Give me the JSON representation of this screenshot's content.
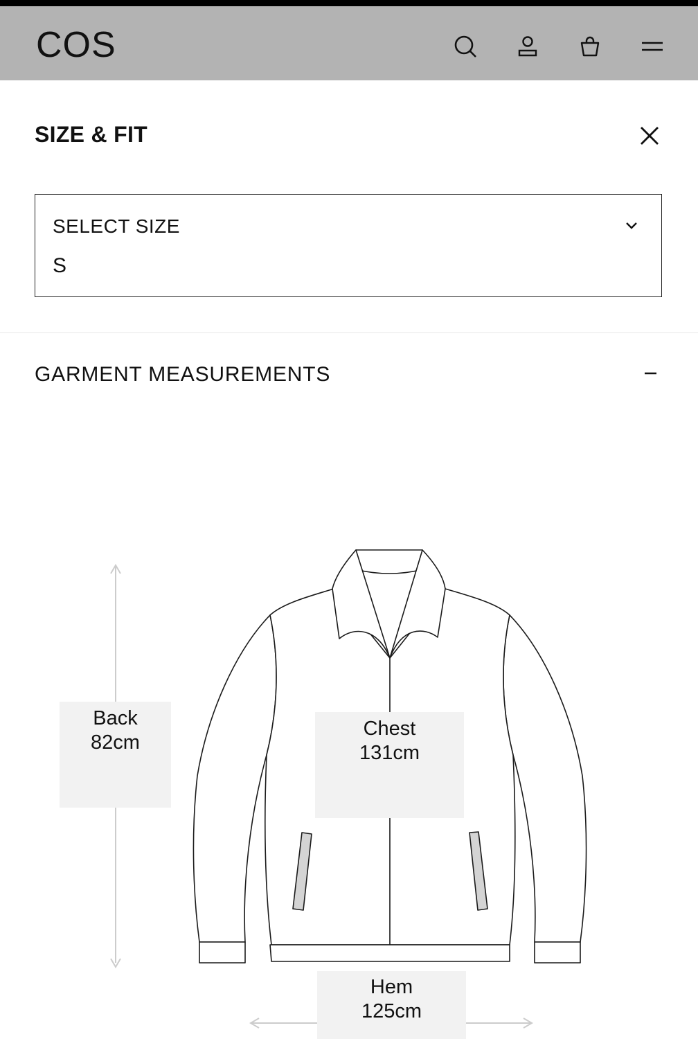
{
  "header": {
    "logo": "COS",
    "icons": [
      "search-icon",
      "account-icon",
      "shopping-bag-icon",
      "menu-icon"
    ]
  },
  "panel": {
    "title": "SIZE & FIT",
    "close_icon": "close-icon"
  },
  "size_select": {
    "label": "SELECT SIZE",
    "value": "S"
  },
  "garment": {
    "title": "GARMENT MEASUREMENTS",
    "toggle_icon": "collapse-minus-icon",
    "measurements": {
      "back": {
        "label": "Back",
        "value": "82cm"
      },
      "chest": {
        "label": "Chest",
        "value": "131cm"
      },
      "hem": {
        "label": "Hem",
        "value": "125cm"
      }
    }
  },
  "colors": {
    "header_bg": "#b3b3b3",
    "box_bg": "#f2f2f2",
    "guide_line": "#cccccc",
    "pocket_fill": "#d4d4d4"
  }
}
